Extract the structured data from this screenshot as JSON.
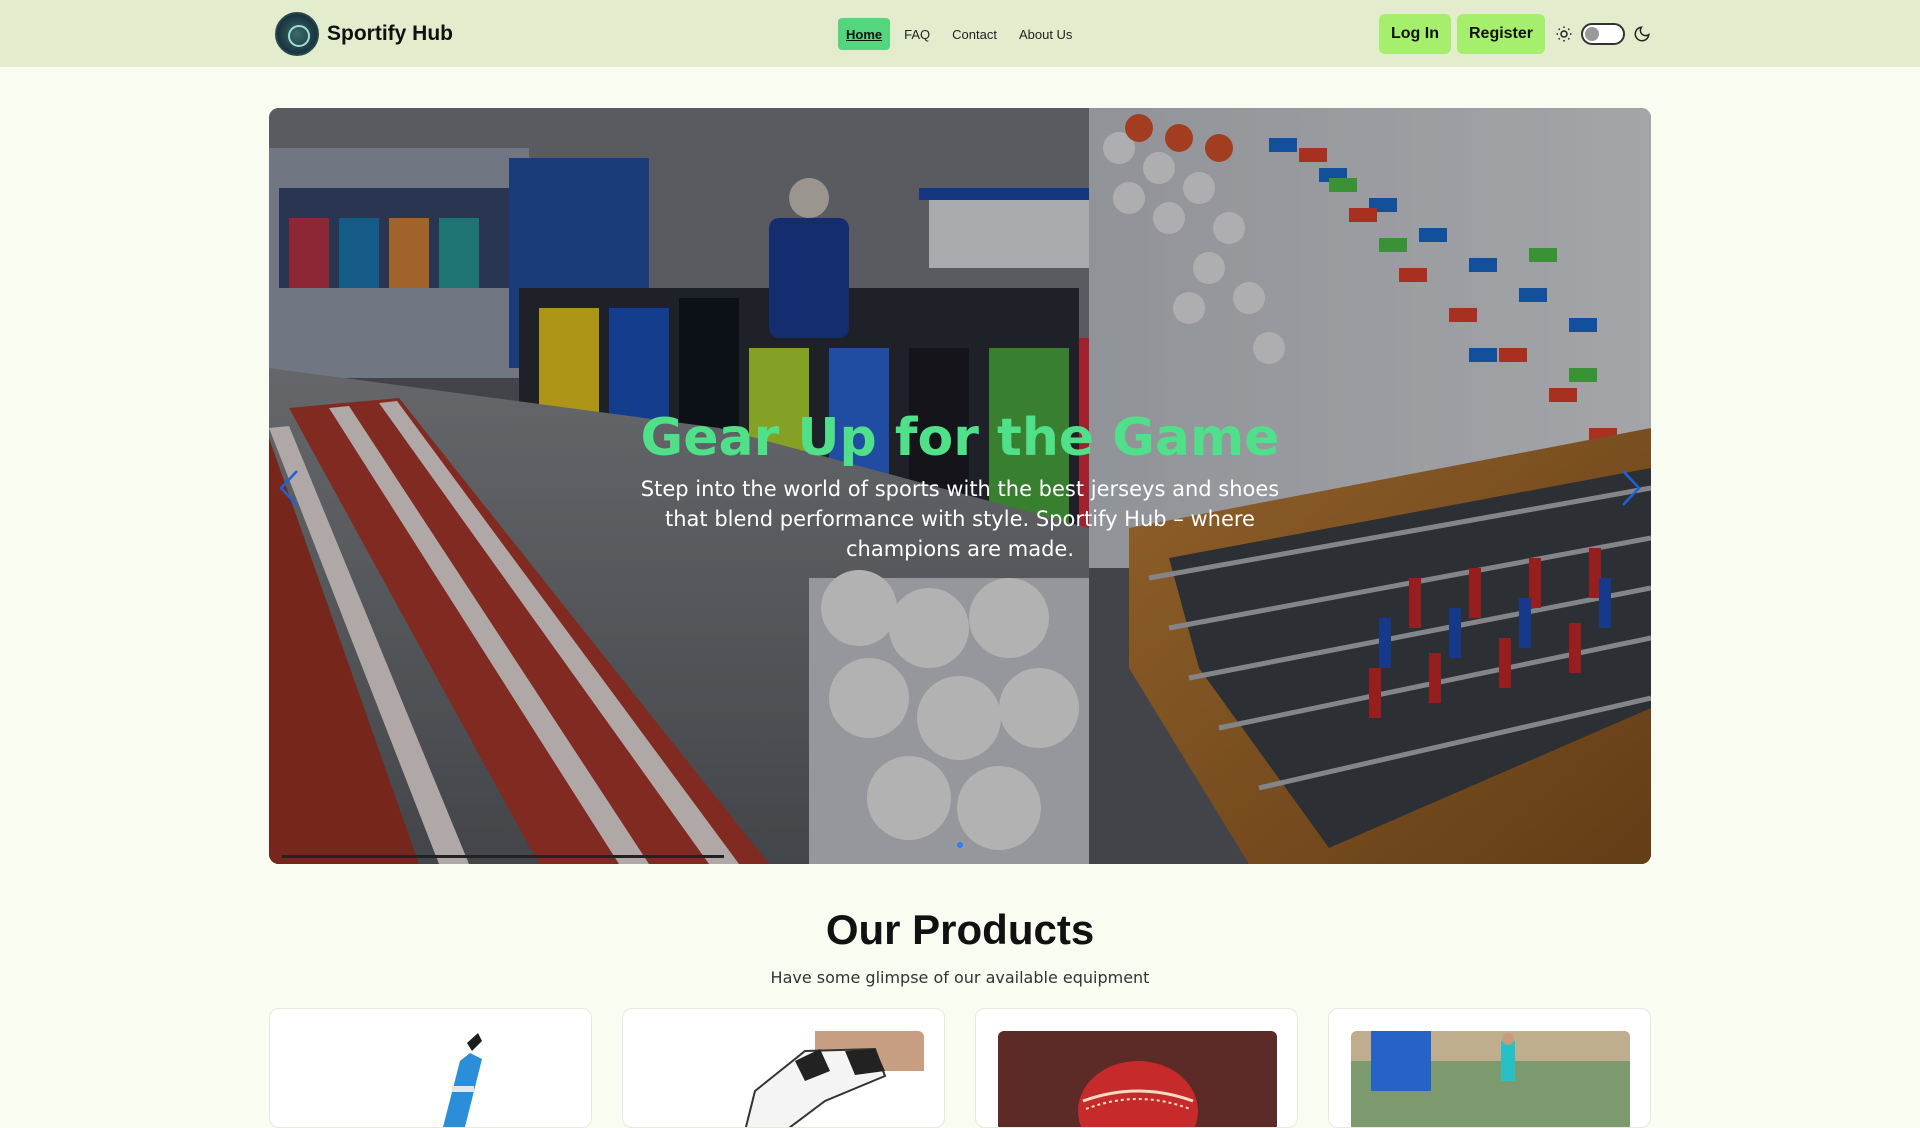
{
  "brand": {
    "name": "Sportify Hub",
    "logo_icon": "logo-icon"
  },
  "nav": {
    "links": [
      {
        "label": "Home",
        "active": true
      },
      {
        "label": "FAQ",
        "active": false
      },
      {
        "label": "Contact",
        "active": false
      },
      {
        "label": "About Us",
        "active": false
      }
    ]
  },
  "auth": {
    "login_label": "Log In",
    "register_label": "Register"
  },
  "theme": {
    "light_icon": "sun-icon",
    "dark_icon": "moon-icon",
    "dark_mode": false
  },
  "hero": {
    "title": "Gear Up for the Game",
    "subtitle": "Step into the world of sports with the best jerseys and shoes that blend performance with style. Sportify Hub – where champions are made.",
    "prev_icon": "chevron-left-icon",
    "next_icon": "chevron-right-icon",
    "active_slide": 0
  },
  "products": {
    "title": "Our Products",
    "subtitle": "Have some glimpse of our available equipment"
  },
  "colors": {
    "navbar_bg": "#e3edcd",
    "accent_green": "#55d67e",
    "button_green": "#a5ef6c",
    "hero_title": "#4fe089",
    "page_bg": "#f9fcf1"
  }
}
